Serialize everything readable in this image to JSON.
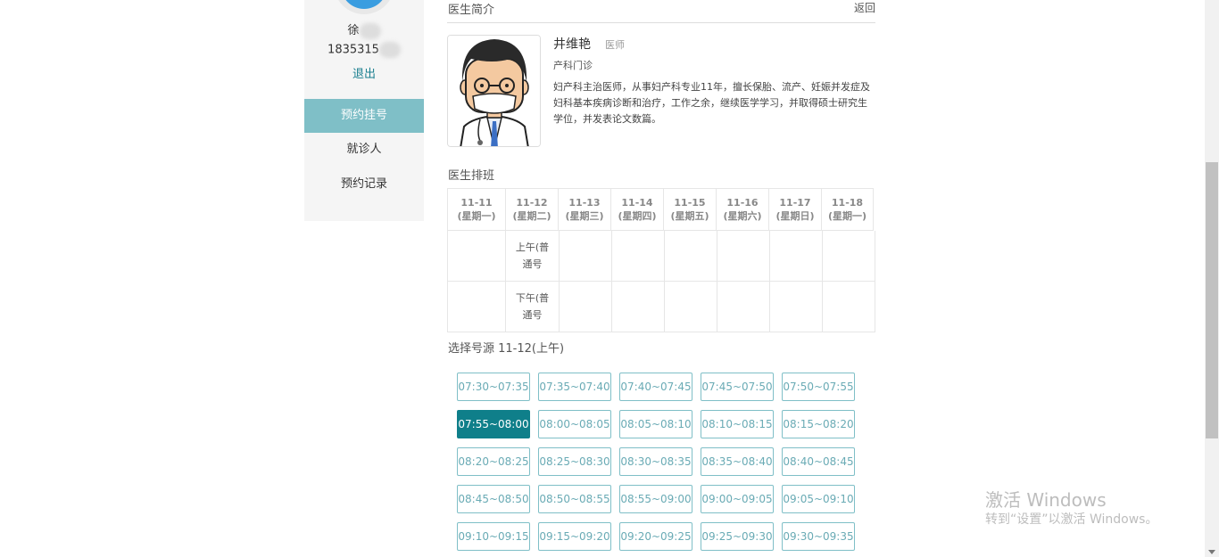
{
  "sidebar": {
    "user_name": "徐",
    "user_phone": "1835315",
    "logout_label": "退出",
    "menu": [
      {
        "label": "预约挂号",
        "active": true
      },
      {
        "label": "就诊人",
        "active": false
      },
      {
        "label": "预约记录",
        "active": false
      }
    ]
  },
  "header": {
    "title": "医生简介",
    "back_label": "返回"
  },
  "doctor": {
    "name": "井维艳",
    "title": "医师",
    "department": "产科门诊",
    "description": "妇产科主治医师，从事妇产科专业11年，擅长保胎、流产、妊娠并发症及妇科基本疾病诊断和治疗，工作之余，继续医学学习，并取得硕士研究生学位，并发表论文数篇。"
  },
  "schedule": {
    "title": "医生排班",
    "days": [
      {
        "date": "11-11",
        "weekday": "(星期一)"
      },
      {
        "date": "11-12",
        "weekday": "(星期二)"
      },
      {
        "date": "11-13",
        "weekday": "(星期三)"
      },
      {
        "date": "11-14",
        "weekday": "(星期四)"
      },
      {
        "date": "11-15",
        "weekday": "(星期五)"
      },
      {
        "date": "11-16",
        "weekday": "(星期六)"
      },
      {
        "date": "11-17",
        "weekday": "(星期日)"
      },
      {
        "date": "11-18",
        "weekday": "(星期一)"
      }
    ],
    "rows": [
      {
        "label": "上午(普通号"
      },
      {
        "label": "下午(普通号"
      }
    ]
  },
  "slots": {
    "title": "选择号源 11-12(上午)",
    "items": [
      "07:30~07:35",
      "07:35~07:40",
      "07:40~07:45",
      "07:45~07:50",
      "07:50~07:55",
      "07:55~08:00",
      "08:00~08:05",
      "08:05~08:10",
      "08:10~08:15",
      "08:15~08:20",
      "08:20~08:25",
      "08:25~08:30",
      "08:30~08:35",
      "08:35~08:40",
      "08:40~08:45",
      "08:45~08:50",
      "08:50~08:55",
      "08:55~09:00",
      "09:00~09:05",
      "09:05~09:10",
      "09:10~09:15",
      "09:15~09:20",
      "09:20~09:25",
      "09:25~09:30",
      "09:30~09:35"
    ],
    "selected": "07:55~08:00"
  },
  "watermark": {
    "line1": "激活 Windows",
    "line2": "转到“设置”以激活 Windows。"
  }
}
